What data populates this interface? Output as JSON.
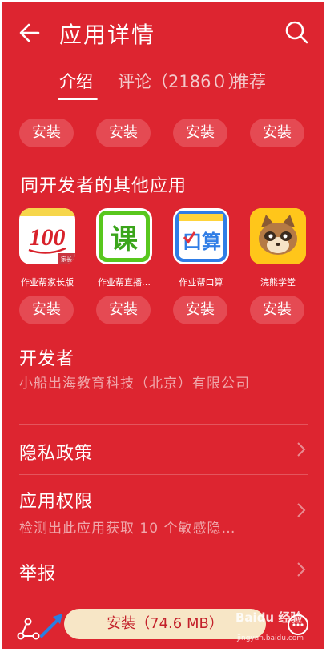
{
  "header": {
    "title": "应用详情",
    "back_icon": "back-arrow-icon",
    "search_icon": "search-icon"
  },
  "tabs": [
    {
      "label": "介绍",
      "active": true
    },
    {
      "label": "评论（2186０）",
      "active": false
    },
    {
      "label": "推荐",
      "active": false
    }
  ],
  "top_install_row": [
    "安装",
    "安装",
    "安装",
    "安装"
  ],
  "same_developer": {
    "title": "同开发者的其他应用",
    "apps": [
      {
        "name": "作业帮家长版",
        "icon_text": "100",
        "badge": "家长",
        "install_label": "安装"
      },
      {
        "name": "作业帮直播…",
        "icon_text": "课",
        "install_label": "安装"
      },
      {
        "name": "作业帮口算",
        "icon_text": "口算",
        "install_label": "安装"
      },
      {
        "name": "浣熊学堂",
        "icon_text": "",
        "install_label": "安装"
      }
    ]
  },
  "developer": {
    "label": "开发者",
    "value": "小船出海教育科技（北京）有限公司"
  },
  "privacy": {
    "label": "隐私政策"
  },
  "permissions": {
    "label": "应用权限",
    "value": "检测出此应用获取 10 个敏感隐…"
  },
  "report": {
    "label": "举报"
  },
  "bottom": {
    "install_label": "安装（74.6 MB）",
    "share_icon": "share-icon",
    "more_icon": "more-icon"
  },
  "watermark": {
    "text": "Baidu 经验",
    "sub": "jingyan.baidu.com"
  },
  "colors": {
    "background": "#dd2530",
    "install_pill": "#e54a53",
    "main_install_bg": "#f7e6c6",
    "main_install_text": "#c3202a"
  }
}
